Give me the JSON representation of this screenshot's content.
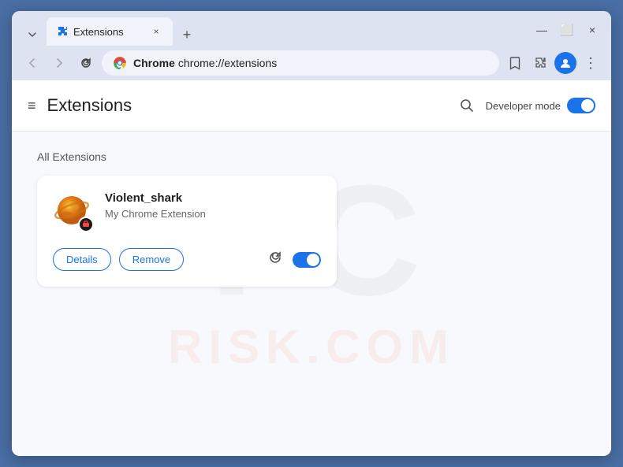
{
  "browser": {
    "title": "Extensions",
    "tab_label": "Extensions",
    "url_brand": "Chrome",
    "url_path": "chrome://extensions",
    "new_tab_symbol": "+",
    "close_symbol": "×",
    "minimize_symbol": "—",
    "maximize_symbol": "⬜",
    "close_window_symbol": "×"
  },
  "nav": {
    "back_disabled": true,
    "forward_disabled": true
  },
  "toolbar": {
    "reload_symbol": "↻",
    "bookmark_symbol": "☆",
    "extensions_symbol": "⊕",
    "profile_symbol": "👤",
    "menu_symbol": "⋮"
  },
  "header": {
    "menu_icon": "≡",
    "title": "Extensions",
    "search_icon": "🔍",
    "developer_mode_label": "Developer mode",
    "developer_mode_enabled": true
  },
  "section": {
    "all_extensions_label": "All Extensions"
  },
  "extension": {
    "name": "Violent_shark",
    "description": "My Chrome Extension",
    "details_label": "Details",
    "remove_label": "Remove",
    "enabled": true
  },
  "watermark": {
    "pc_text": "PC",
    "risk_text": "RISK.COM"
  }
}
